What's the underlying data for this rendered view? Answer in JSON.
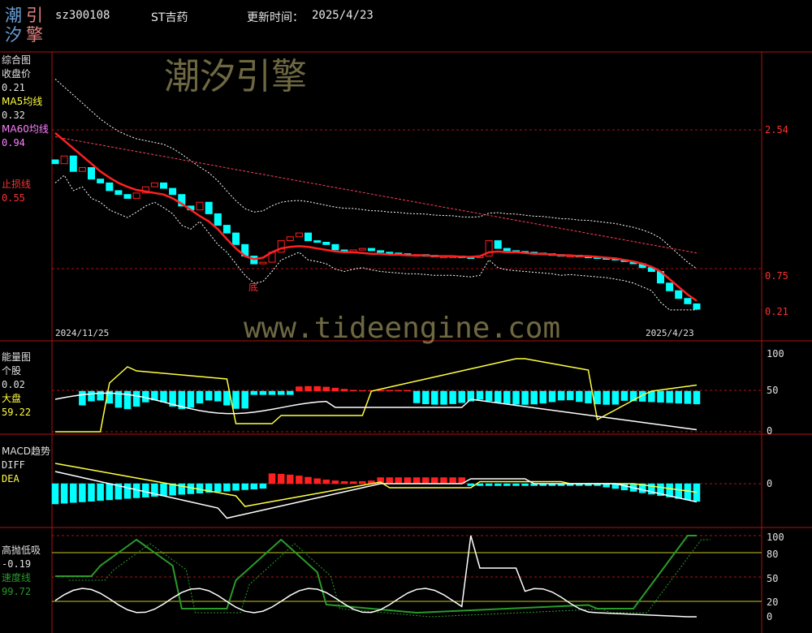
{
  "header": {
    "logo_chars": [
      "潮",
      "引",
      "汐",
      "擎"
    ],
    "stock_code": "sz300108",
    "stock_name": "ST吉药",
    "update_label": "更新时间：",
    "update_date": "2025/4/23"
  },
  "colors": {
    "red": "#ff2020",
    "cyan": "#00ffff",
    "yellow": "#ffff40",
    "white": "#ffffff",
    "green": "#2a9a2a",
    "pink": "#ff80ff",
    "grid": "#b01010"
  },
  "watermark": {
    "top_text": "潮汐引擎",
    "bottom_text": "www.tideengine.com"
  },
  "panel_main": {
    "title": "综合图",
    "close_label": "收盘价",
    "close_value": "0.21",
    "ma5_label": "MA5均线",
    "ma5_value": "0.32",
    "ma60_label": "MA60均线",
    "ma60_value": "0.94",
    "stop_label": "止损线",
    "stop_value": "0.55",
    "y_ticks": [
      "2.54",
      "0.75",
      "0.21"
    ],
    "date_start": "2024/11/25",
    "date_end": "2025/4/23",
    "bottom_marker": "底"
  },
  "panel_energy": {
    "title": "能量图",
    "stock_label": "个股",
    "stock_value": "0.02",
    "market_label": "大盘",
    "market_value": "59.22",
    "y_ticks": [
      "100",
      "50",
      "0"
    ]
  },
  "panel_macd": {
    "title": "MACD趋势",
    "diff_label": "DIFF",
    "dea_label": "DEA",
    "y_ticks": [
      "0"
    ]
  },
  "panel_tide": {
    "title": "高抛低吸",
    "value": "-0.19",
    "speed_label": "速度线",
    "speed_value": "99.72",
    "y_ticks": [
      "100",
      "80",
      "50",
      "20",
      "0"
    ]
  },
  "chart_data": [
    {
      "type": "candlestick",
      "title": "综合图",
      "x_range": [
        "2024/11/25",
        "2025/4/23"
      ],
      "ylim": [
        0.21,
        2.54
      ],
      "close": [
        2.1,
        2.2,
        2.0,
        2.05,
        1.9,
        1.85,
        1.75,
        1.7,
        1.65,
        1.72,
        1.8,
        1.85,
        1.78,
        1.7,
        1.55,
        1.5,
        1.6,
        1.45,
        1.3,
        1.2,
        1.05,
        0.9,
        0.8,
        0.82,
        0.95,
        1.1,
        1.15,
        1.2,
        1.1,
        1.08,
        1.05,
        0.98,
        0.95,
        0.98,
        1.0,
        0.97,
        0.95,
        0.94,
        0.93,
        0.92,
        0.92,
        0.91,
        0.9,
        0.9,
        0.9,
        0.89,
        0.88,
        0.9,
        1.1,
        1.0,
        0.97,
        0.96,
        0.95,
        0.94,
        0.93,
        0.92,
        0.9,
        0.91,
        0.9,
        0.89,
        0.88,
        0.87,
        0.85,
        0.83,
        0.8,
        0.75,
        0.7,
        0.55,
        0.45,
        0.35,
        0.28,
        0.21
      ],
      "ma5": [
        2.5,
        2.4,
        2.3,
        2.2,
        2.1,
        2.0,
        1.92,
        1.85,
        1.8,
        1.76,
        1.74,
        1.72,
        1.7,
        1.65,
        1.58,
        1.5,
        1.42,
        1.35,
        1.25,
        1.12,
        1.0,
        0.9,
        0.86,
        0.88,
        0.95,
        1.0,
        1.02,
        1.03,
        1.02,
        1.0,
        0.98,
        0.96,
        0.95,
        0.95,
        0.94,
        0.93,
        0.93,
        0.92,
        0.92,
        0.91,
        0.91,
        0.91,
        0.9,
        0.9,
        0.9,
        0.89,
        0.89,
        0.9,
        0.95,
        0.96,
        0.95,
        0.95,
        0.94,
        0.93,
        0.93,
        0.92,
        0.91,
        0.91,
        0.9,
        0.9,
        0.89,
        0.88,
        0.87,
        0.85,
        0.83,
        0.8,
        0.76,
        0.7,
        0.6,
        0.5,
        0.4,
        0.32
      ],
      "ma60_end": 0.94,
      "stop_loss": 0.55
    },
    {
      "type": "bar",
      "title": "能量图",
      "ylim": [
        0,
        100
      ],
      "series": [
        {
          "name": "个股",
          "last": 0.02
        },
        {
          "name": "大盘",
          "last": 59.22
        }
      ]
    },
    {
      "type": "bar",
      "title": "MACD趋势",
      "series": [
        {
          "name": "DIFF"
        },
        {
          "name": "DEA"
        }
      ]
    },
    {
      "type": "line",
      "title": "高抛低吸",
      "ylim": [
        0,
        100
      ],
      "series": [
        {
          "name": "高抛低吸",
          "last": -0.19
        },
        {
          "name": "速度线",
          "last": 99.72
        }
      ]
    }
  ]
}
